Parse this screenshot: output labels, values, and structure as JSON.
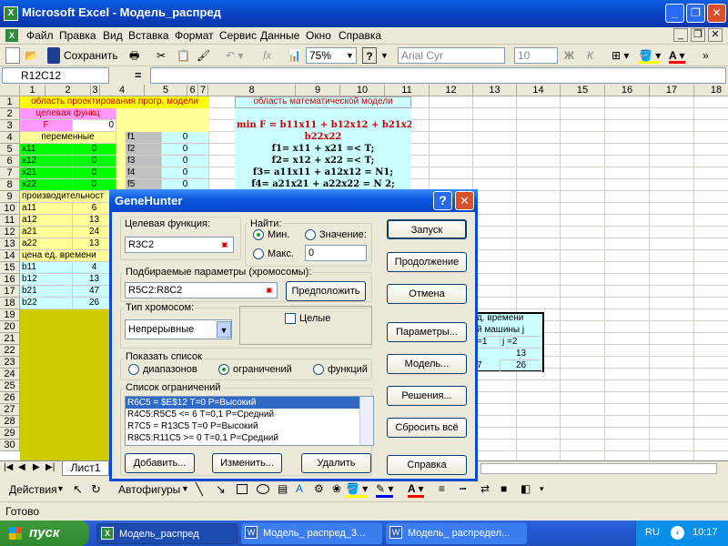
{
  "window": {
    "title": "Microsoft Excel - Модель_распред"
  },
  "menu": [
    "Файл",
    "Правка",
    "Вид",
    "Вставка",
    "Формат",
    "Сервис",
    "Данные",
    "Окно",
    "Справка"
  ],
  "toolbar": {
    "save_label": "Сохранить",
    "zoom": "75%",
    "font": "Arial Cyr",
    "size": "10",
    "bold": "Ж",
    "italic": "К"
  },
  "formula": {
    "namebox": "R12C12",
    "equals": "="
  },
  "columns": [
    "1",
    "2",
    "3",
    "4",
    "5",
    "6",
    "7",
    "8",
    "9",
    "10",
    "11",
    "12",
    "13",
    "14",
    "15",
    "16",
    "17",
    "18"
  ],
  "rows": [
    "1",
    "2",
    "3",
    "4",
    "5",
    "6",
    "7",
    "8",
    "9",
    "10",
    "11",
    "12",
    "13",
    "14",
    "15",
    "16",
    "17",
    "18",
    "19",
    "20",
    "21",
    "22",
    "23",
    "24",
    "25",
    "26",
    "27",
    "28",
    "29",
    "30"
  ],
  "cells": {
    "r1_design": "область проектирования прогр. модели",
    "r1_math": "область математической модели",
    "r2_target": "целевая функц",
    "r3_F": "F",
    "r3_val": "0",
    "r4_vars": "переменные",
    "vars": [
      [
        "x11",
        "0"
      ],
      [
        "x12",
        "0"
      ],
      [
        "x21",
        "0"
      ],
      [
        "x22",
        "0"
      ]
    ],
    "fs": [
      [
        "f1",
        "0"
      ],
      [
        "f2",
        "0"
      ],
      [
        "f3",
        "0"
      ],
      [
        "f4",
        "0"
      ],
      [
        "f5",
        "0"
      ]
    ],
    "r9_prod": "производительност",
    "as": [
      [
        "a11",
        "6"
      ],
      [
        "a12",
        "13"
      ],
      [
        "a21",
        "24"
      ],
      [
        "a22",
        "13"
      ]
    ],
    "r14_cost": "цена ед. времени",
    "bs": [
      [
        "b11",
        "4"
      ],
      [
        "b12",
        "13"
      ],
      [
        "b21",
        "47"
      ],
      [
        "b22",
        "26"
      ]
    ],
    "math": [
      "min F = b11x11 + b12x12 + b21x21 +",
      "b22x22",
      "f1= x11 + x21 =< T;",
      "f2= x12 + x22 =< T;",
      "f3= a11x11 + a12x12 = N1;",
      "f4= a21x21 + a22x22 = N 2;"
    ],
    "rt_time": "д. времени",
    "rt_machine": "й машины j",
    "rt_j1": "=1",
    "rt_j2": "j =2",
    "rt_13": "13",
    "rt_7": "7",
    "rt_26": "26"
  },
  "dialog": {
    "title": "GeneHunter",
    "help_icon": "?",
    "target_label": "Целевая функция:",
    "target_value": "R3C2",
    "find_label": "Найти:",
    "min_label": "Мин.",
    "max_label": "Макс.",
    "value_label": "Значение:",
    "value_field": "0",
    "params_label": "Подбираемые параметры (хромосомы):",
    "params_value": "R5C2:R8C2",
    "guess_button": "Предположить",
    "chrom_label": "Тип хромосом:",
    "chrom_value": "Непрерывные",
    "integer_label": "Целые",
    "show_label": "Показать список",
    "show_options": [
      "диапазонов",
      "ограничений",
      "функций"
    ],
    "constraints_label": "Список ограничений",
    "constraints": [
      "R6C5 = $E$12 T=0 P=Высокий",
      "R4C5:R5C5 <= 6 T=0,1 P=Средний",
      "R7C5 = R13C5 T=0 P=Высокий",
      "R8C5:R11C5 >= 0 T=0,1 P=Средний"
    ],
    "add_button": "Добавить...",
    "change_button": "Изменить...",
    "delete_button": "Удалить",
    "side_buttons": [
      "Запуск",
      "Продолжение",
      "Отмена",
      "Параметры...",
      "Модель...",
      "Решения...",
      "Сбросить всё",
      "Справка"
    ]
  },
  "sheet_tab": "Лист1",
  "drawing": {
    "actions": "Действия",
    "autoshapes": "Автофигуры"
  },
  "status": "Готово",
  "taskbar": {
    "start": "пуск",
    "tasks": [
      "Модель_распред",
      "Модель_ распред_3...",
      "Модель_ распредел..."
    ],
    "lang": "RU",
    "time": "10:17"
  },
  "colors": {
    "yellow": "#ffff99",
    "green": "#00ff00",
    "pink": "#ff99ff",
    "cyan": "#ccffff",
    "olive": "#cccc00",
    "gray": "#c0c0c0"
  }
}
